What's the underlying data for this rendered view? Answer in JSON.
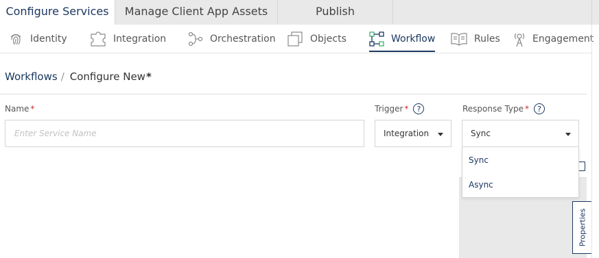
{
  "top_tabs": [
    {
      "label": "Configure Services",
      "active": true
    },
    {
      "label": "Manage Client App Assets",
      "active": false
    },
    {
      "label": "Publish",
      "active": false
    }
  ],
  "subnav": [
    {
      "label": "Identity",
      "icon": "fingerprint-icon"
    },
    {
      "label": "Integration",
      "icon": "puzzle-icon"
    },
    {
      "label": "Orchestration",
      "icon": "orchestration-icon"
    },
    {
      "label": "Objects",
      "icon": "objects-icon"
    },
    {
      "label": "Workflow",
      "icon": "workflow-icon",
      "active": true
    },
    {
      "label": "Rules",
      "icon": "rules-book-icon"
    },
    {
      "label": "Engagement",
      "icon": "engagement-icon"
    }
  ],
  "breadcrumb": {
    "root": "Workflows",
    "separator": "/",
    "current": "Configure New",
    "unsaved_marker": "*"
  },
  "form": {
    "name": {
      "label": "Name",
      "required": "*",
      "placeholder": "Enter Service Name",
      "value": ""
    },
    "trigger": {
      "label": "Trigger",
      "required": "*",
      "help": "?",
      "value": "Integration"
    },
    "response_type": {
      "label": "Response Type",
      "required": "*",
      "help": "?",
      "value": "Sync",
      "options": [
        "Sync",
        "Async"
      ]
    }
  },
  "properties_tab": {
    "label": "Properties"
  },
  "colors": {
    "accent": "#1a3760",
    "required": "#d02c2c",
    "tab_bar": "#e9e9e9",
    "workflow_icon": "#3cb371"
  }
}
